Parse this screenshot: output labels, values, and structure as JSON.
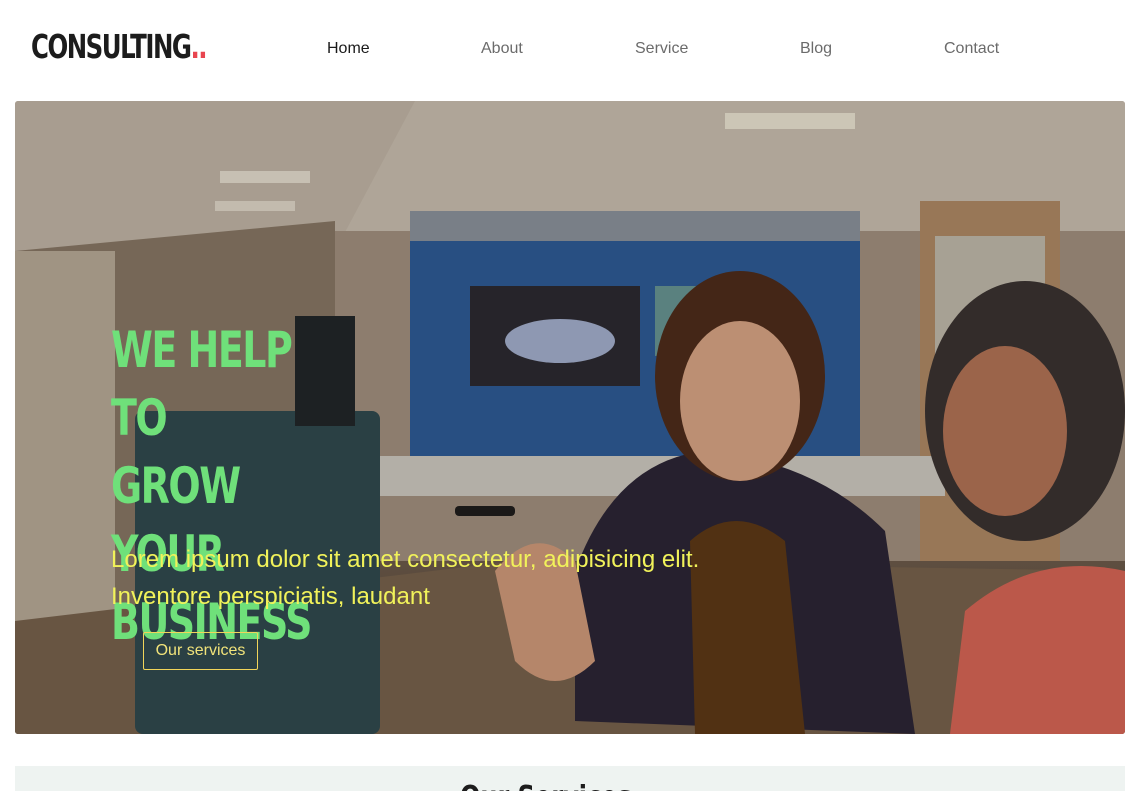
{
  "brand": {
    "name": "CONSULTING",
    "dots": "..",
    "dots_color": "#e8454f"
  },
  "nav": {
    "items": [
      {
        "label": "Home",
        "active": true
      },
      {
        "label": "About",
        "active": false
      },
      {
        "label": "Service",
        "active": false
      },
      {
        "label": "Blog",
        "active": false
      },
      {
        "label": "Contact",
        "active": false
      }
    ]
  },
  "hero": {
    "title_lines": [
      "WE HELP TO",
      "GROW YOUR",
      "BUSINESS"
    ],
    "text_line_1": "Lorem ipsum dolor sit amet consectetur, adipisicing elit.",
    "text_line_2": "Inventore perspiciatis, laudant",
    "button_label": "Our services",
    "title_color": "#6fe07a",
    "text_color": "#f1f25a"
  },
  "next_section": {
    "title": "Our Services"
  }
}
